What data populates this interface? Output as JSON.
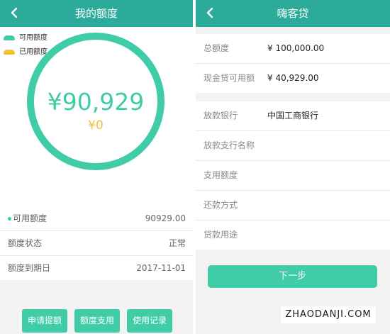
{
  "left_screen": {
    "title": "我的额度",
    "legend": [
      {
        "label": "可用额度",
        "color": "#3fcca6"
      },
      {
        "label": "已用额度",
        "color": "#f1c232"
      }
    ],
    "ring": {
      "available": "¥90,929",
      "used": "¥0",
      "available_fraction": 1.0
    },
    "info_rows": [
      {
        "label": "可用额度",
        "value": "90929.00"
      },
      {
        "label": "额度状态",
        "value": "正常"
      },
      {
        "label": "额度到期日",
        "value": "2017-11-01"
      }
    ],
    "buttons": [
      "申请提额",
      "额度支用",
      "使用记录"
    ]
  },
  "right_screen": {
    "title": "嗨客贷",
    "summary": [
      {
        "label": "总额度",
        "value": "¥ 100,000.00"
      },
      {
        "label": "现金贷可用额",
        "value": "¥ 40,929.00"
      }
    ],
    "form_rows": [
      {
        "label": "放款银行",
        "value": "中国工商银行"
      },
      {
        "label": "放款支行名称",
        "value": ""
      },
      {
        "label": "支用额度",
        "value": ""
      },
      {
        "label": "还款方式",
        "value": ""
      },
      {
        "label": "贷款用途",
        "value": ""
      }
    ],
    "next_button": "下一步"
  },
  "watermark": "ZHAODANJI.COM",
  "colors": {
    "header": "#2cab9a",
    "accent": "#3fcca6",
    "used": "#f1c232"
  }
}
